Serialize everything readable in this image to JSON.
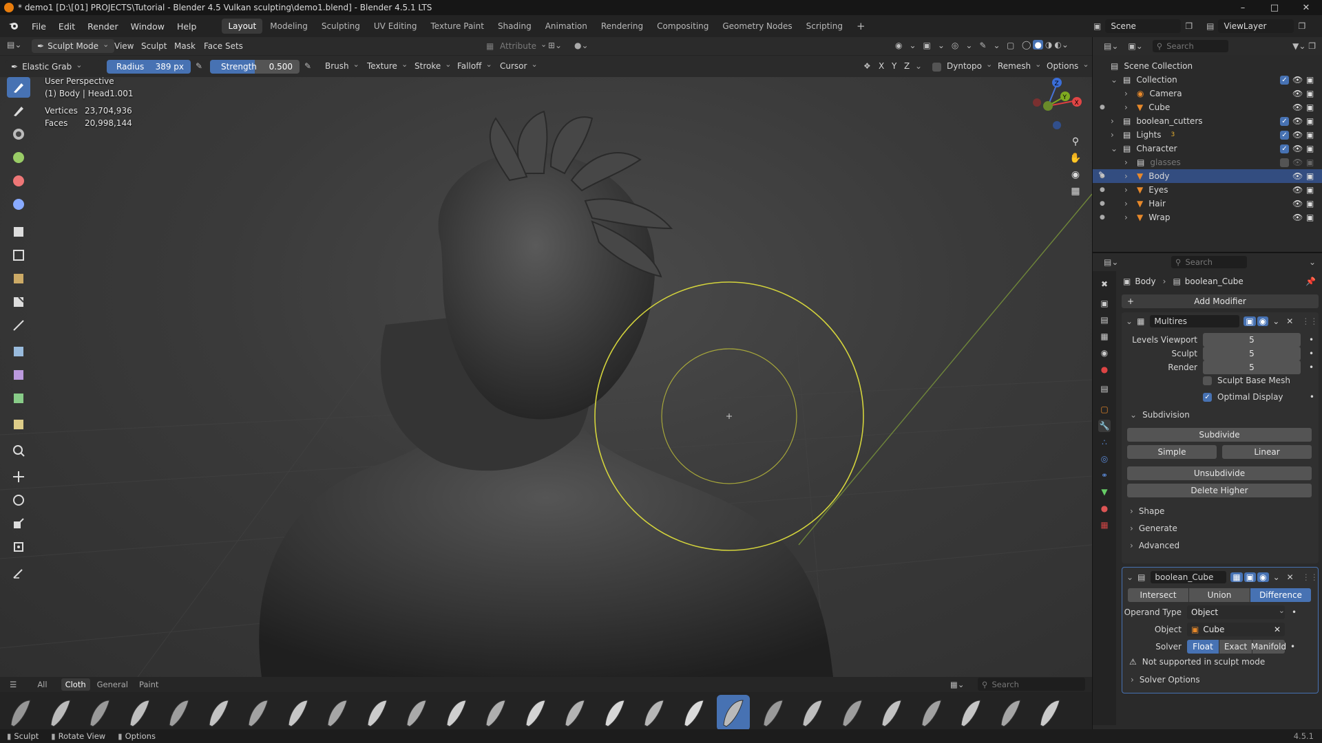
{
  "window": {
    "title": "* demo1 [D:\\[01] PROJECTS\\Tutorial - Blender 4.5 Vulkan sculpting\\demo1.blend] - Blender 4.5.1 LTS"
  },
  "menu": [
    "File",
    "Edit",
    "Render",
    "Window",
    "Help"
  ],
  "workspaces": [
    "Layout",
    "Modeling",
    "Sculpting",
    "UV Editing",
    "Texture Paint",
    "Shading",
    "Animation",
    "Rendering",
    "Compositing",
    "Geometry Nodes",
    "Scripting"
  ],
  "active_workspace": "Layout",
  "scene": {
    "name": "Scene",
    "view_layer": "ViewLayer"
  },
  "viewport_header": {
    "mode": "Sculpt Mode",
    "menus": [
      "View",
      "Sculpt",
      "Mask",
      "Face Sets"
    ],
    "attribute": "Attribute"
  },
  "tool_settings": {
    "tool": "Elastic Grab",
    "radius_label": "Radius",
    "radius_value": "389 px",
    "strength_label": "Strength",
    "strength_value": "0.500",
    "menus": [
      "Brush",
      "Texture",
      "Stroke",
      "Falloff",
      "Cursor"
    ],
    "axes": [
      "X",
      "Y",
      "Z"
    ],
    "dyntopo": "Dyntopo",
    "remesh": "Remesh",
    "options": "Options"
  },
  "overlay": {
    "perspective": "User Perspective",
    "object": "(1) Body | Head1.001",
    "vertices_label": "Vertices",
    "vertices": "23,704,936",
    "faces_label": "Faces",
    "faces": "20,998,144"
  },
  "gizmo": {
    "x": "X",
    "y": "Y",
    "z": "Z"
  },
  "asset_shelf": {
    "tabs": [
      "All",
      "Cloth",
      "General",
      "Paint"
    ],
    "active_tab": "Cloth",
    "search_placeholder": "Search"
  },
  "statusbar": {
    "items": [
      "Sculpt",
      "Rotate View",
      "Options"
    ],
    "version": "4.5.1"
  },
  "outliner": {
    "search_placeholder": "Search",
    "root": "Scene Collection",
    "rows": [
      {
        "label": "Collection",
        "icon": "collection-icon"
      },
      {
        "label": "Camera",
        "icon": "camera-icon"
      },
      {
        "label": "Cube",
        "icon": "mesh-icon"
      },
      {
        "label": "boolean_cutters",
        "icon": "collection-icon"
      },
      {
        "label": "Lights",
        "icon": "collection-icon",
        "badge": "3"
      },
      {
        "label": "Character",
        "icon": "collection-icon"
      },
      {
        "label": "glasses",
        "icon": "collection-icon"
      },
      {
        "label": "Body",
        "icon": "mesh-icon"
      },
      {
        "label": "Eyes",
        "icon": "mesh-icon"
      },
      {
        "label": "Hair",
        "icon": "mesh-icon"
      },
      {
        "label": "Wrap",
        "icon": "mesh-icon"
      }
    ]
  },
  "properties": {
    "search_placeholder": "Search",
    "breadcrumb_object": "Body",
    "breadcrumb_modifier": "boolean_Cube",
    "add_modifier": "Add Modifier",
    "multires": {
      "name": "Multires",
      "levels_viewport_label": "Levels Viewport",
      "levels_viewport": "5",
      "sculpt_label": "Sculpt",
      "sculpt": "5",
      "render_label": "Render",
      "render": "5",
      "sculpt_base_mesh": "Sculpt Base Mesh",
      "optimal_display": "Optimal Display",
      "subdivision": "Subdivision",
      "subdivide": "Subdivide",
      "simple": "Simple",
      "linear": "Linear",
      "unsubdivide": "Unsubdivide",
      "delete_higher": "Delete Higher",
      "shape": "Shape",
      "generate": "Generate",
      "advanced": "Advanced"
    },
    "boolean": {
      "name": "boolean_Cube",
      "intersect": "Intersect",
      "union": "Union",
      "difference": "Difference",
      "operand_type_label": "Operand Type",
      "operand_type": "Object",
      "object_label": "Object",
      "object": "Cube",
      "solver_label": "Solver",
      "float": "Float",
      "exact": "Exact",
      "manifold": "Manifold",
      "warning": "Not supported in sculpt mode",
      "solver_options": "Solver Options"
    }
  },
  "colors": {
    "accent": "#4772b3",
    "brush_circle": "#d4d43c",
    "selection": "#334d80"
  }
}
